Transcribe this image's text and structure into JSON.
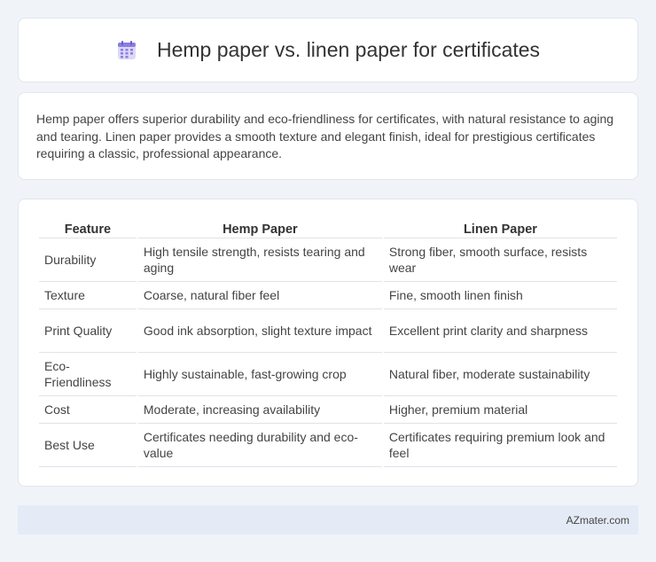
{
  "header": {
    "title": "Hemp paper vs. linen paper for certificates",
    "icon": "calendar-icon"
  },
  "intro": {
    "text": "Hemp paper offers superior durability and eco-friendliness for certificates, with natural resistance to aging and tearing. Linen paper provides a smooth texture and elegant finish, ideal for prestigious certificates requiring a classic, professional appearance."
  },
  "table": {
    "columns": [
      "Feature",
      "Hemp Paper",
      "Linen Paper"
    ],
    "rows": [
      [
        "Durability",
        "High tensile strength, resists tearing and aging",
        "Strong fiber, smooth surface, resists wear"
      ],
      [
        "Texture",
        "Coarse, natural fiber feel",
        "Fine, smooth linen finish"
      ],
      [
        "Print Quality",
        "Good ink absorption, slight texture impact",
        "Excellent print clarity and sharpness"
      ],
      [
        "Eco-Friendliness",
        "Highly sustainable, fast-growing crop",
        "Natural fiber, moderate sustainability"
      ],
      [
        "Cost",
        "Moderate, increasing availability",
        "Higher, premium material"
      ],
      [
        "Best Use",
        "Certificates needing durability and eco-value",
        "Certificates requiring premium look and feel"
      ]
    ]
  },
  "footer": {
    "brand": "AZmater.com"
  },
  "colors": {
    "page_background": "#f0f3f8",
    "footer_background": "#e5ebf6",
    "icon_accent": "#8a7ee0"
  }
}
